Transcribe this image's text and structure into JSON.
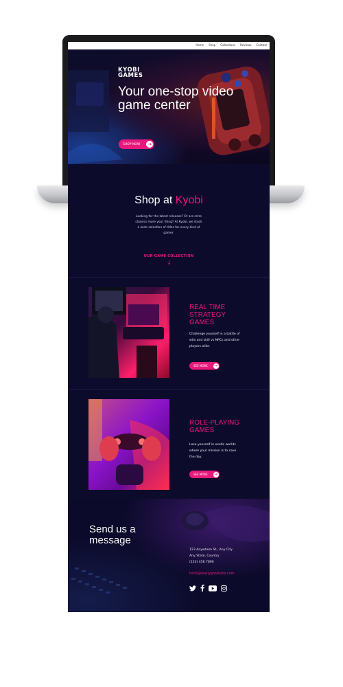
{
  "nav": {
    "items": [
      "Home",
      "Shop",
      "Collections",
      "Reviews",
      "Contact"
    ]
  },
  "hero": {
    "logo_line1": "KYOBI",
    "logo_line2": "GAMES",
    "title": "Your one-stop video game center",
    "cta": "SHOP NOW"
  },
  "shop": {
    "title_prefix": "Shop at",
    "title_accent": "Kyobi",
    "text": "Looking for the latest releases? Or are retro classics more your thing? At Kyobi, we stock a wide selection of titles for every kind of gamer.",
    "collection_label": "OUR GAME COLLECTION"
  },
  "games": [
    {
      "title": "REAL TIME STRATEGY GAMES",
      "text": "Challenge yourself in a battle of wits and skill vs NPCs and other players alike.",
      "cta": "SEE MORE"
    },
    {
      "title": "ROLE-PLAYING GAMES",
      "text": "Lose yourself in exotic worlds where your mission is to save the day.",
      "cta": "SEE MORE"
    }
  ],
  "contact": {
    "title": "Send us a message",
    "address_line1": "123 Anywhere St., Any City",
    "address_line2": "Any State, Country",
    "phone": "(123) 456 7890",
    "email": "hello@reallygreatsite.com"
  },
  "socials": [
    "twitter-icon",
    "facebook-icon",
    "youtube-icon",
    "instagram-icon"
  ],
  "colors": {
    "accent": "#e8197a",
    "background": "#0d0b2c"
  }
}
